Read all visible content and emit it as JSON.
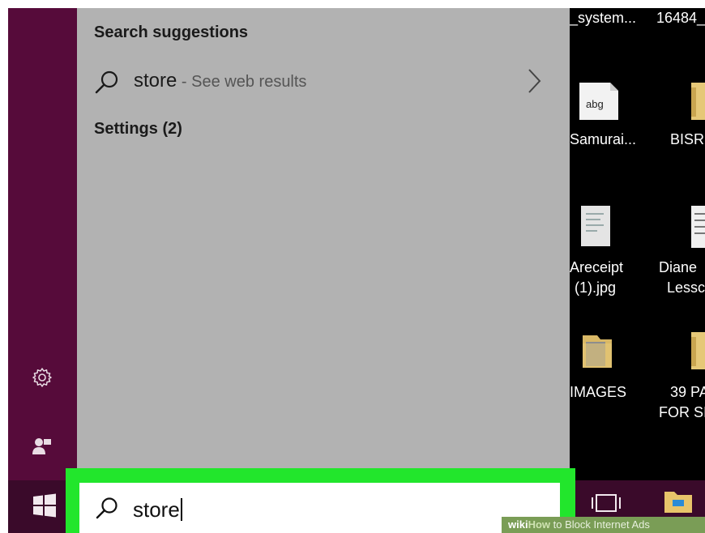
{
  "search_panel": {
    "suggestions_heading": "Search suggestions",
    "suggestion": {
      "term": "store",
      "separator": " - ",
      "subtitle": "See web results"
    },
    "settings_heading": "Settings (2)"
  },
  "search_box": {
    "query": "store"
  },
  "desktop": {
    "top_labels": [
      "_system...",
      "16484_"
    ],
    "icons": [
      {
        "label_lines": [
          "Samurai..."
        ],
        "icon": "abg-file-icon",
        "badge": "abg"
      },
      {
        "label_lines": [
          "BISR"
        ],
        "icon": "folder-icon"
      },
      {
        "label_lines": [
          "Areceipt",
          "(1).jpg"
        ],
        "icon": "image-file-icon"
      },
      {
        "label_lines": [
          "Diane",
          "Lessc"
        ],
        "icon": "document-icon"
      },
      {
        "label_lines": [
          "IMAGES"
        ],
        "icon": "folder-icon"
      },
      {
        "label_lines": [
          "39 PA",
          "FOR SI"
        ],
        "icon": "folder-icon"
      }
    ]
  },
  "watermark": {
    "wiki": "wiki",
    "how": "How",
    "text": " to Block Internet Ads"
  },
  "colors": {
    "sidebar": "#560b3a",
    "panel": "#b2b2b2",
    "highlight": "#22e62c",
    "taskbar": "#3a0a2a"
  }
}
